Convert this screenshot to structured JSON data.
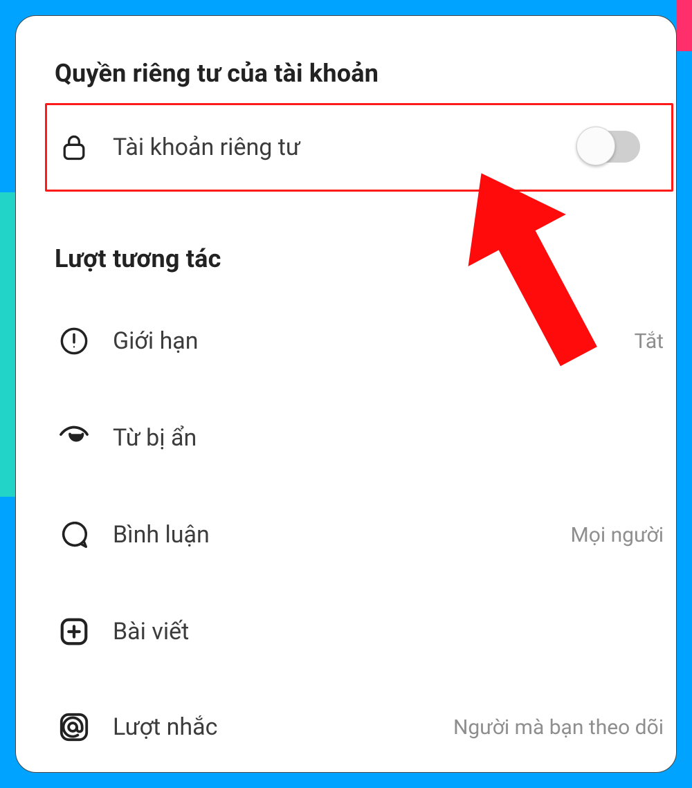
{
  "sections": {
    "privacy": {
      "title": "Quyền riêng tư của tài khoản",
      "private_account_label": "Tài khoản riêng tư",
      "private_account_on": false
    },
    "interactions": {
      "title": "Lượt tương tác",
      "limits": {
        "label": "Giới hạn",
        "value": "Tắt"
      },
      "hidden_words": {
        "label": "Từ bị ẩn"
      },
      "comments": {
        "label": "Bình luận",
        "value": "Mọi người"
      },
      "posts": {
        "label": "Bài viết"
      },
      "mentions": {
        "label": "Lượt nhắc",
        "value": "Người mà bạn theo dõi"
      }
    }
  }
}
